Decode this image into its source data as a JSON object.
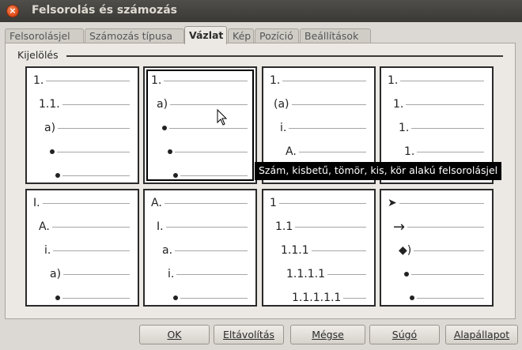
{
  "window": {
    "title": "Felsorolás és számozás",
    "close_glyph": "×"
  },
  "tabs": [
    {
      "label": "Felsorolásjel",
      "active": false
    },
    {
      "label": "Számozás típusa",
      "active": false
    },
    {
      "label": "Vázlat",
      "active": true
    },
    {
      "label": "Kép",
      "active": false
    },
    {
      "label": "Pozíció",
      "active": false
    },
    {
      "label": "Beállítások",
      "active": false
    }
  ],
  "selection": {
    "frame_label": "Kijelölés"
  },
  "outlines": [
    {
      "rows": [
        "1.",
        "1.1.",
        "a)",
        "•",
        "•"
      ]
    },
    {
      "rows": [
        "1.",
        "a)",
        "•",
        "•",
        "•"
      ],
      "selected": true
    },
    {
      "rows": [
        "1.",
        "(a)",
        "i.",
        "A.",
        ""
      ]
    },
    {
      "rows": [
        "1.",
        "1.",
        "1.",
        "1.",
        ""
      ]
    },
    {
      "rows": [
        "I.",
        "A.",
        "i.",
        "a)",
        "•"
      ]
    },
    {
      "rows": [
        "A.",
        "I.",
        "a.",
        "i.",
        "•"
      ]
    },
    {
      "rows": [
        "1",
        "1.1",
        "1.1.1",
        "1.1.1.1",
        "1.1.1.1.1"
      ]
    },
    {
      "rows": [
        "➤",
        "→",
        "◆)",
        "•",
        "•"
      ]
    }
  ],
  "tooltip": {
    "text": "Szám, kisbetű, tömör, kis, kör alakú felsorolásjel"
  },
  "buttons": {
    "ok": "OK",
    "remove": "Eltávolítás",
    "cancel": "Mégse",
    "help": "Súgó",
    "reset": "Alapállapot"
  }
}
